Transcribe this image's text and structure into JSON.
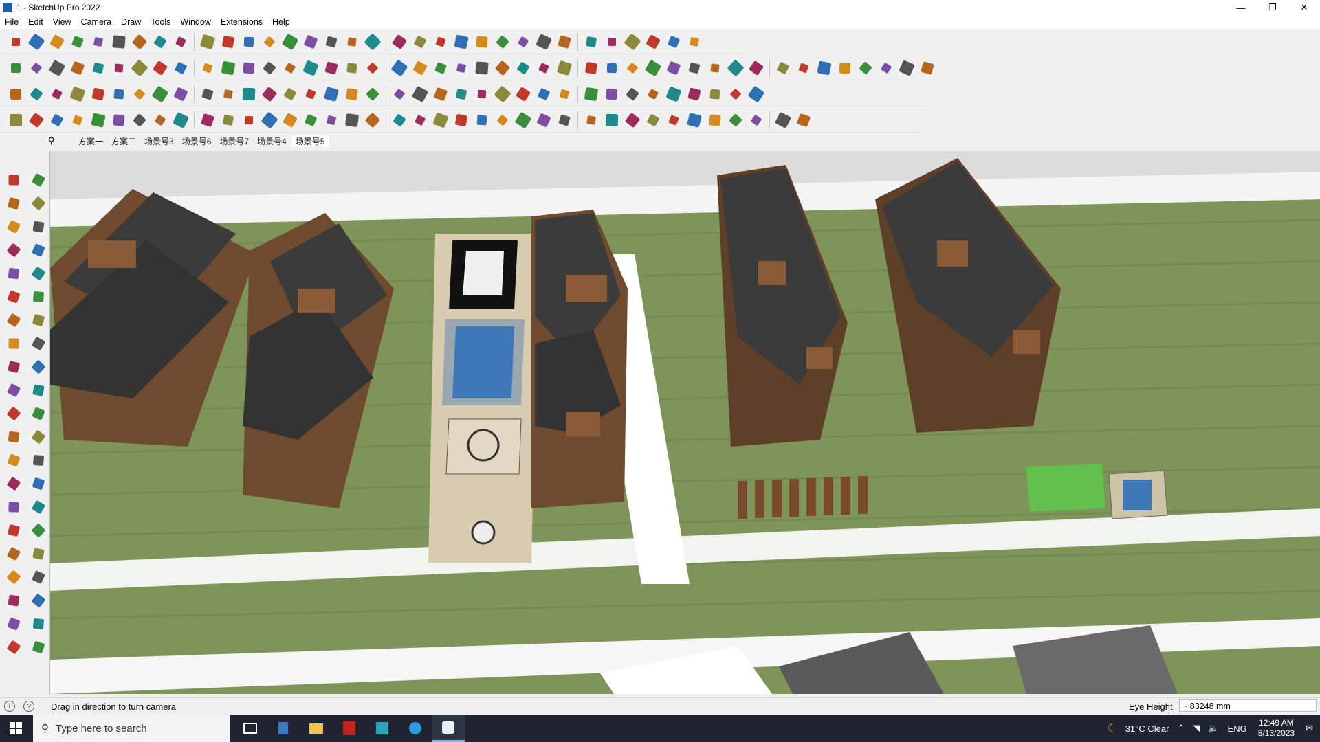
{
  "window": {
    "title": "1 - SketchUp Pro 2022",
    "minimize": "—",
    "maximize": "❐",
    "close": "✕"
  },
  "menu": [
    "File",
    "Edit",
    "View",
    "Camera",
    "Draw",
    "Tools",
    "Window",
    "Extensions",
    "Help"
  ],
  "toolbar_icons": {
    "row1": [
      "zoom-icon",
      "select-icon",
      "eraser-icon",
      "pencil-icon",
      "lasso-icon",
      "rect-icon",
      "push-icon",
      "follow-icon",
      "move-icon",
      "rotate-icon",
      "scale-icon",
      "tape-icon",
      "text-icon",
      "paint-icon",
      "orbit-icon",
      "pan-icon",
      "zoom-window-icon",
      "zoom-extents-icon",
      "section-icon",
      "layers-icon",
      "styles-icon",
      "scenes-icon",
      "user-icon",
      "warehouse-icon",
      "extension-icon",
      "sandbox-icon",
      "up-icon",
      "down-icon",
      "measure-icon",
      "frame-icon",
      "undo-icon",
      "redo-icon",
      "gift-icon"
    ],
    "row2": [
      "iso-icon",
      "top-icon",
      "front-icon",
      "right-icon",
      "back-icon",
      "left-icon",
      "bottom-icon",
      "shade-icon",
      "xray-icon",
      "wire-icon",
      "hidden-icon",
      "texture-icon",
      "mono-icon",
      "sketch-icon",
      "house-icon",
      "door-icon",
      "window-icon",
      "roof-icon",
      "stair-icon",
      "wall-icon",
      "fence-icon",
      "tree-icon",
      "fx-icon",
      "hand-icon",
      "ruler-icon",
      "shape-icon",
      "circle-icon",
      "poly-icon",
      "ellipse-icon",
      "quad-icon",
      "arc-icon",
      "curve-icon",
      "spline-icon",
      "loop-icon",
      "ring-icon",
      "knife-icon",
      "pink-icon",
      "tex1-icon",
      "tex2-icon",
      "tex3-icon",
      "tex4-icon",
      "tex5-icon",
      "tex6-icon",
      "tex7-icon"
    ],
    "row3": [
      "solid1-icon",
      "solid2-icon",
      "solid3-icon",
      "solid4-icon",
      "solid5-icon",
      "solid6-icon",
      "undo2-icon",
      "sq-icon",
      "bars-icon",
      "frame2-icon",
      "box-icon",
      "hook-icon",
      "line-icon",
      "plus-icon",
      "cross-icon",
      "move2-icon",
      "cone-icon",
      "tri-icon",
      "loop2-icon",
      "spiral-icon",
      "swirl-icon",
      "arrows-icon",
      "cup-icon",
      "return-icon",
      "leaf-icon",
      "joint-icon",
      "cubes-icon",
      "boxes-icon",
      "tag-icon",
      "grid1-icon",
      "grid2-icon",
      "grid3-icon",
      "grid4-icon",
      "dots-icon",
      "dash-icon",
      "net-icon"
    ],
    "row4": [
      "pathA-icon",
      "pathB-icon",
      "pathC-icon",
      "cut-icon",
      "gear1-icon",
      "gear2-icon",
      "gear3-icon",
      "gear4-icon",
      "gear5-icon",
      "gear6-icon",
      "gear7-icon",
      "corner1-icon",
      "corner2-icon",
      "corner3-icon",
      "curve2-icon",
      "frame3-icon",
      "tent-icon",
      "rail1-icon",
      "rail2-icon",
      "rail3-icon",
      "rail4-icon",
      "rail5-icon",
      "rail6-icon",
      "rail7-icon",
      "rail8-icon",
      "rail9-icon",
      "rail10-icon",
      "rail11-icon",
      "rail12-icon",
      "rail13-icon",
      "rail14-icon",
      "rail15-icon",
      "rail16-icon",
      "rail17-icon",
      "rail18-icon",
      "rail19-icon",
      "rail20-icon",
      "rail21-icon"
    ]
  },
  "scene_tabs": [
    "方案一",
    "方案二",
    "场景号3",
    "场景号6",
    "场景号7",
    "场景号4",
    "场景号5"
  ],
  "active_scene": "场景号5",
  "left_tools": [
    "select-tool-icon",
    "orbit-tool-icon",
    "paint-tool-icon",
    "eraser-tool-icon",
    "component-tool-icon",
    "tape-tool-icon",
    "line-tool-icon",
    "freehand-tool-icon",
    "rectangle-tool-icon",
    "rotated-rect-tool-icon",
    "circle-tool-icon",
    "polygon-tool-icon",
    "arc-tool-icon",
    "pie-tool-icon",
    "3pt-arc-tool-icon",
    "2pt-arc-tool-icon",
    "move-tool-icon",
    "pushpull-tool-icon",
    "rotate-tool-icon",
    "followme-tool-icon",
    "scale-tool-icon",
    "offset-tool-icon",
    "tape-measure-tool-icon",
    "dimension-tool-icon",
    "protractor-tool-icon",
    "text-tool-icon",
    "axes-tool-icon",
    "3dtext-tool-icon",
    "orbit2-tool-icon",
    "pan-tool-icon",
    "zoom-tool-icon",
    "zoom-window-tool-icon",
    "zoom-extents-tool-icon",
    "previous-view-tool-icon",
    "position-camera-tool-icon",
    "look-around-tool-icon",
    "walk-tool-icon",
    "section-plane-tool-icon",
    "display-section-tool-icon",
    "section-cuts-tool-icon",
    "section-fill-tool-icon",
    "layers-tool-icon"
  ],
  "status": {
    "message": "Drag in direction to turn camera",
    "measure_label": "Eye Height",
    "measure_value": "~ 83248 mm"
  },
  "taskbar": {
    "search_placeholder": "Type here to search",
    "apps": [
      "taskview-icon",
      "calculator-icon",
      "explorer-icon",
      "acrobat-icon",
      "app-icon",
      "edge-icon",
      "sketchup-icon"
    ],
    "weather": "31°C  Clear",
    "lang": "ENG",
    "time": "12:49 AM",
    "date": "8/13/2023"
  },
  "colors": {
    "roof": "#3b3b3b",
    "facade": "#6e4a2e",
    "lawn": "#7e9459",
    "pool": "#3f78b8",
    "paving": "#d8cbb0",
    "road": "#ffffff",
    "sky": "#dcdcdc"
  }
}
